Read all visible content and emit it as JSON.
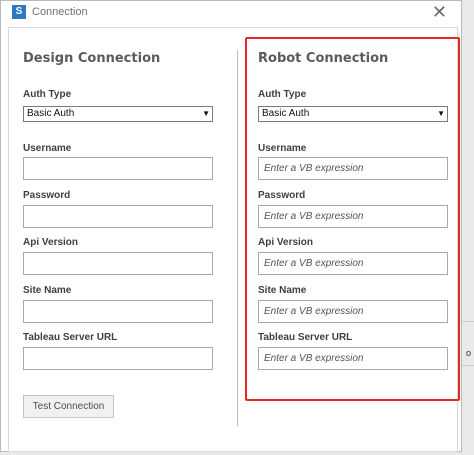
{
  "window": {
    "title": "Connection",
    "app_icon_glyph": "S",
    "close_glyph": "✕"
  },
  "design": {
    "title": "Design Connection",
    "auth_type_label": "Auth Type",
    "auth_type_value": "Basic Auth",
    "username_label": "Username",
    "password_label": "Password",
    "api_version_label": "Api Version",
    "site_name_label": "Site Name",
    "server_url_label": "Tableau Server URL",
    "test_button": "Test Connection"
  },
  "robot": {
    "title": "Robot Connection",
    "auth_type_label": "Auth Type",
    "auth_type_value": "Basic Auth",
    "username_label": "Username",
    "password_label": "Password",
    "api_version_label": "Api Version",
    "site_name_label": "Site Name",
    "server_url_label": "Tableau Server URL",
    "placeholder": "Enter a VB expression"
  },
  "background": {
    "glyph": "o"
  },
  "colors": {
    "highlight": "#e02a24",
    "app_icon": "#2f78c5"
  }
}
